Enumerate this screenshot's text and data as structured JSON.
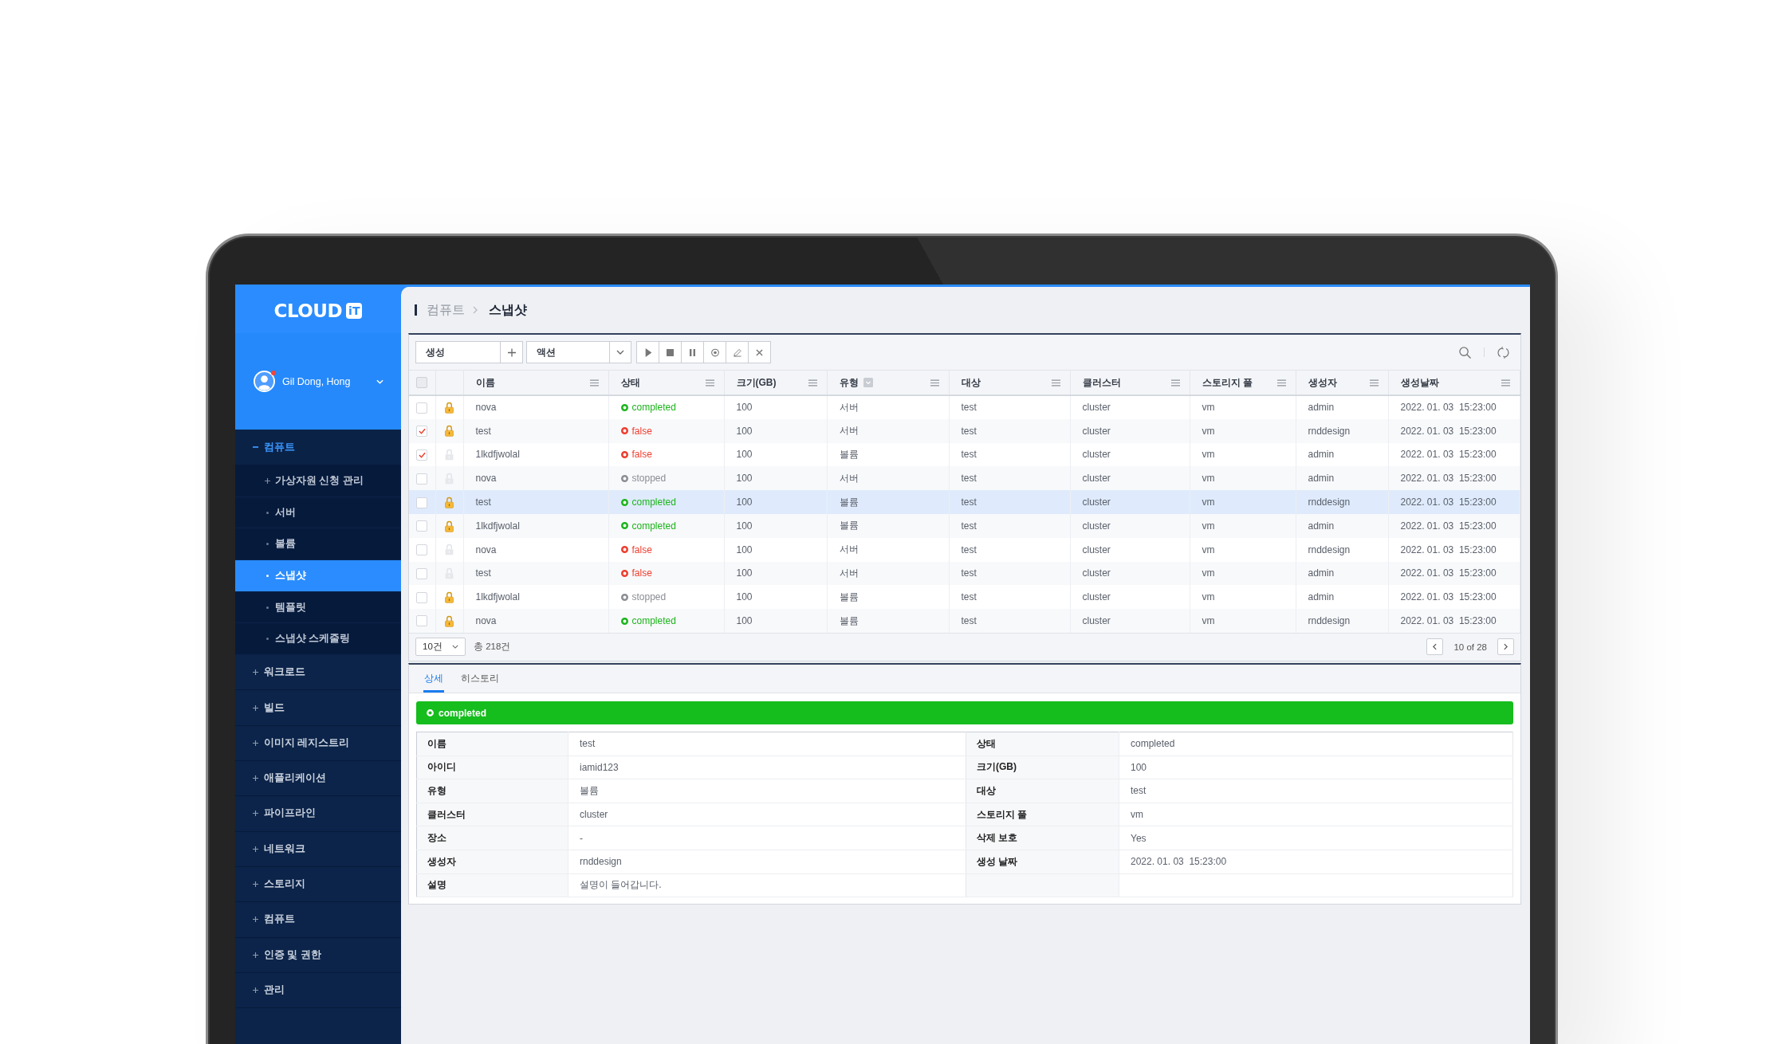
{
  "sidebar": {
    "logo": {
      "word": "CLOUD",
      "suffix": "iT"
    },
    "user": {
      "name": "Gil Dong, Hong",
      "notification": true
    },
    "menu": [
      {
        "label": "컴퓨트",
        "expanded": true,
        "children": [
          {
            "label": "가상자원 신청 관리",
            "kind": "group",
            "expanded": false,
            "selected": false
          },
          {
            "label": "서버",
            "kind": "page",
            "selected": false
          },
          {
            "label": "볼륨",
            "kind": "page",
            "selected": false
          },
          {
            "label": "스냅샷",
            "kind": "page",
            "selected": true
          },
          {
            "label": "템플릿",
            "kind": "page",
            "selected": false
          },
          {
            "label": "스냅샷 스케줄링",
            "kind": "page",
            "selected": false
          }
        ]
      },
      {
        "label": "워크로드",
        "expanded": false
      },
      {
        "label": "빌드",
        "expanded": false
      },
      {
        "label": "이미지 레지스트리",
        "expanded": false
      },
      {
        "label": "애플리케이션",
        "expanded": false
      },
      {
        "label": "파이프라인",
        "expanded": false
      },
      {
        "label": "네트워크",
        "expanded": false
      },
      {
        "label": "스토리지",
        "expanded": false
      },
      {
        "label": "컴퓨트",
        "expanded": false
      },
      {
        "label": "인증 및 권한",
        "expanded": false
      },
      {
        "label": "관리",
        "expanded": false
      }
    ]
  },
  "breadcrumb": [
    "컴퓨트",
    "스냅샷"
  ],
  "toolbar": {
    "create": "생성",
    "action": "액션"
  },
  "table": {
    "all_checked": false,
    "columns": [
      {
        "label": "이름",
        "filter": false
      },
      {
        "label": "상태",
        "filter": false
      },
      {
        "label": "크기(GB)",
        "filter": false
      },
      {
        "label": "유형",
        "filter": true
      },
      {
        "label": "대상",
        "filter": false
      },
      {
        "label": "클러스터",
        "filter": false
      },
      {
        "label": "스토리지 풀",
        "filter": false
      },
      {
        "label": "생성자",
        "filter": false
      },
      {
        "label": "생성날짜",
        "filter": false
      }
    ],
    "rows": [
      {
        "checked": false,
        "locked": true,
        "selected": false,
        "name": "nova",
        "status": {
          "label": "completed",
          "color": "#1cb41c"
        },
        "size": "100",
        "type": "서버",
        "target": "test",
        "cluster": "cluster",
        "pool": "vm",
        "creator": "admin",
        "created": "2022. 01. 03  15:23:00"
      },
      {
        "checked": true,
        "locked": true,
        "selected": false,
        "name": "test",
        "status": {
          "label": "false",
          "color": "#ee3d2f"
        },
        "size": "100",
        "type": "서버",
        "target": "test",
        "cluster": "cluster",
        "pool": "vm",
        "creator": "rnddesign",
        "created": "2022. 01. 03  15:23:00"
      },
      {
        "checked": true,
        "locked": false,
        "selected": false,
        "name": "1lkdfjwolal",
        "status": {
          "label": "false",
          "color": "#ee3d2f"
        },
        "size": "100",
        "type": "볼륨",
        "target": "test",
        "cluster": "cluster",
        "pool": "vm",
        "creator": "admin",
        "created": "2022. 01. 03  15:23:00"
      },
      {
        "checked": false,
        "locked": false,
        "selected": false,
        "name": "nova",
        "status": {
          "label": "stopped",
          "color": "#8a8d93"
        },
        "size": "100",
        "type": "서버",
        "target": "test",
        "cluster": "cluster",
        "pool": "vm",
        "creator": "admin",
        "created": "2022. 01. 03  15:23:00"
      },
      {
        "checked": false,
        "locked": true,
        "selected": true,
        "name": "test",
        "status": {
          "label": "completed",
          "color": "#1cb41c"
        },
        "size": "100",
        "type": "볼륨",
        "target": "test",
        "cluster": "cluster",
        "pool": "vm",
        "creator": "rnddesign",
        "created": "2022. 01. 03  15:23:00"
      },
      {
        "checked": false,
        "locked": true,
        "selected": false,
        "name": "1lkdfjwolal",
        "status": {
          "label": "completed",
          "color": "#1cb41c"
        },
        "size": "100",
        "type": "볼륨",
        "target": "test",
        "cluster": "cluster",
        "pool": "vm",
        "creator": "admin",
        "created": "2022. 01. 03  15:23:00"
      },
      {
        "checked": false,
        "locked": false,
        "selected": false,
        "name": "nova",
        "status": {
          "label": "false",
          "color": "#ee3d2f"
        },
        "size": "100",
        "type": "서버",
        "target": "test",
        "cluster": "cluster",
        "pool": "vm",
        "creator": "rnddesign",
        "created": "2022. 01. 03  15:23:00"
      },
      {
        "checked": false,
        "locked": false,
        "selected": false,
        "name": "test",
        "status": {
          "label": "false",
          "color": "#ee3d2f"
        },
        "size": "100",
        "type": "서버",
        "target": "test",
        "cluster": "cluster",
        "pool": "vm",
        "creator": "admin",
        "created": "2022. 01. 03  15:23:00"
      },
      {
        "checked": false,
        "locked": true,
        "selected": false,
        "name": "1lkdfjwolal",
        "status": {
          "label": "stopped",
          "color": "#8a8d93"
        },
        "size": "100",
        "type": "볼륨",
        "target": "test",
        "cluster": "cluster",
        "pool": "vm",
        "creator": "admin",
        "created": "2022. 01. 03  15:23:00"
      },
      {
        "checked": false,
        "locked": true,
        "selected": false,
        "name": "nova",
        "status": {
          "label": "completed",
          "color": "#1cb41c"
        },
        "size": "100",
        "type": "볼륨",
        "target": "test",
        "cluster": "cluster",
        "pool": "vm",
        "creator": "rnddesign",
        "created": "2022. 01. 03  15:23:00"
      }
    ]
  },
  "pagination": {
    "page_size": "10건",
    "total": "총 218건",
    "page": "10 of 28"
  },
  "detail": {
    "tabs": [
      {
        "label": "상세",
        "selected": true
      },
      {
        "label": "히스토리",
        "selected": false
      }
    ],
    "banner": {
      "label": "completed"
    },
    "rows": [
      {
        "left": {
          "label": "이름",
          "value": "test"
        },
        "right": {
          "label": "상태",
          "value": "completed"
        }
      },
      {
        "left": {
          "label": "아이디",
          "value": "iamid123"
        },
        "right": {
          "label": "크기(GB)",
          "value": "100"
        }
      },
      {
        "left": {
          "label": "유형",
          "value": "볼륨"
        },
        "right": {
          "label": "대상",
          "value": "test"
        }
      },
      {
        "left": {
          "label": "클러스터",
          "value": "cluster"
        },
        "right": {
          "label": "스토리지 풀",
          "value": "vm"
        }
      },
      {
        "left": {
          "label": "장소",
          "value": "-"
        },
        "right": {
          "label": "삭제 보호",
          "value": "Yes"
        }
      },
      {
        "left": {
          "label": "생성자",
          "value": "rnddesign"
        },
        "right": {
          "label": "생성 날짜",
          "value": "2022. 01. 03  15:23:00"
        }
      },
      {
        "left": {
          "label": "설명",
          "value": "설명이 들어갑니다."
        }
      }
    ]
  }
}
